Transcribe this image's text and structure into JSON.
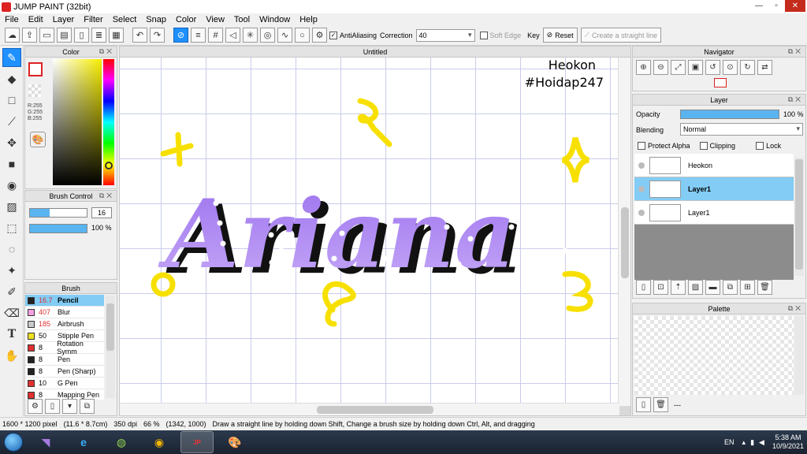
{
  "window": {
    "title": "JUMP PAINT (32bit)"
  },
  "menu": [
    "File",
    "Edit",
    "Layer",
    "Filter",
    "Select",
    "Snap",
    "Color",
    "View",
    "Tool",
    "Window",
    "Help"
  ],
  "toolbar": {
    "antialiasing_label": "AntiAliasing",
    "correction_label": "Correction",
    "correction_value": "40",
    "soft_edge_label": "Soft Edge",
    "key_label": "Key",
    "reset_label": "Reset",
    "straight_line_label": "Create a straight line"
  },
  "color_panel": {
    "title": "Color",
    "r": "R:255",
    "g": "G:255",
    "b": "B:255"
  },
  "brush_control": {
    "title": "Brush Control",
    "size": "16",
    "opacity": "100 %",
    "opacity_fraction": 1.0,
    "size_fraction": 0.35
  },
  "brush_panel": {
    "title": "Brush",
    "items": [
      {
        "size": "16.7",
        "name": "Pencil",
        "color": "#222222",
        "size_color": "#e03030",
        "selected": true
      },
      {
        "size": "407",
        "name": "Blur",
        "color": "#f4a0e0",
        "size_color": "#e03030"
      },
      {
        "size": "185",
        "name": "Airbrush",
        "color": "#c8c8c8",
        "size_color": "#e03030"
      },
      {
        "size": "50",
        "name": "Stipple Pen",
        "color": "#f0e020",
        "size_color": "#000000"
      },
      {
        "size": "8",
        "name": "Rotation Symm",
        "color": "#e03030",
        "size_color": "#000000"
      },
      {
        "size": "8",
        "name": "Pen",
        "color": "#222222",
        "size_color": "#000000"
      },
      {
        "size": "8",
        "name": "Pen (Sharp)",
        "color": "#222222",
        "size_color": "#000000"
      },
      {
        "size": "10",
        "name": "G Pen",
        "color": "#e03030",
        "size_color": "#000000"
      },
      {
        "size": "8",
        "name": "Mapping Pen",
        "color": "#e03030",
        "size_color": "#000000"
      }
    ]
  },
  "canvas": {
    "tab": "Untitled",
    "signature_line1": "Heokon",
    "signature_line2": "#Hoidap247",
    "artwork_text": "Ariana"
  },
  "navigator": {
    "title": "Navigator"
  },
  "layer_panel": {
    "title": "Layer",
    "opacity_label": "Opacity",
    "opacity_value": "100 %",
    "blending_label": "Blending",
    "blending_value": "Normal",
    "protect_alpha": "Protect Alpha",
    "clipping": "Clipping",
    "lock": "Lock",
    "layers": [
      {
        "name": "Heokon",
        "selected": false,
        "bold": false
      },
      {
        "name": "Layer1",
        "selected": true,
        "bold": true
      },
      {
        "name": "Layer1",
        "selected": false,
        "bold": false
      }
    ]
  },
  "palette_panel": {
    "title": "Palette",
    "footer": "---"
  },
  "status": {
    "size": "1600 * 1200 pixel",
    "cm": "(11.6 * 8.7cm)",
    "dpi": "350 dpi",
    "zoom": "66 %",
    "coords": "(1342, 1000)",
    "hint": "Draw a straight line by holding down Shift, Change a brush size by holding down Ctrl, Alt, and dragging"
  },
  "taskbar": {
    "lang": "EN",
    "time": "5:38 AM",
    "date": "10/9/2021",
    "apps": [
      "visual-studio-icon",
      "ie-icon",
      "game-icon",
      "chrome-icon",
      "jump-paint-icon",
      "paint-icon"
    ]
  },
  "colors": {
    "accent": "#1e90ff",
    "selection": "#82ccf5",
    "purple": "#a97ff0",
    "yellow": "#f7e000"
  }
}
